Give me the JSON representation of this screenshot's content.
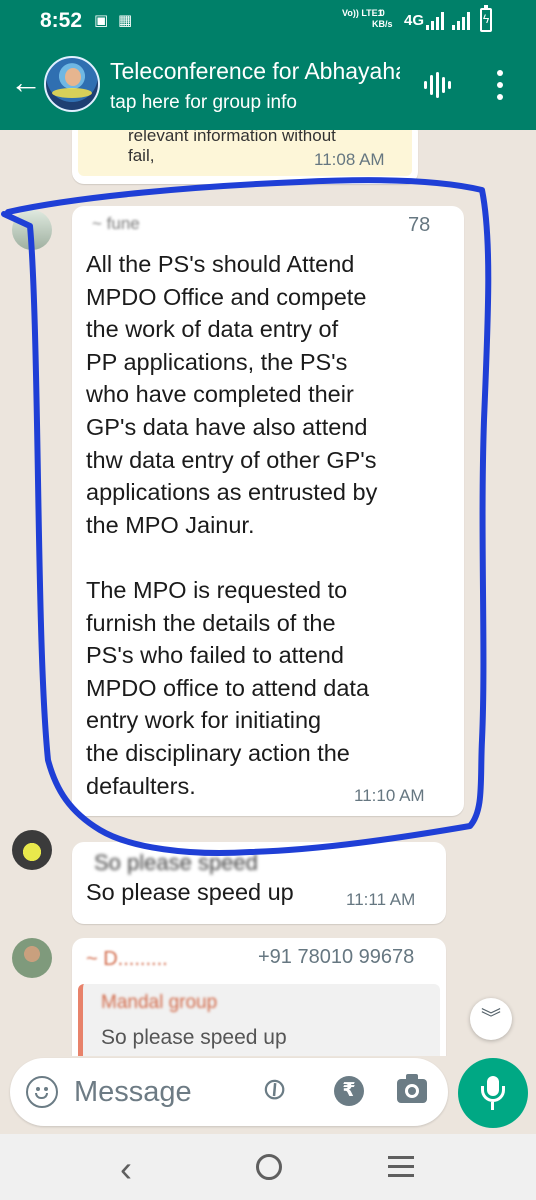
{
  "status_bar": {
    "time": "8:52",
    "indicators": [
      "gallery-icon",
      "calendar-icon"
    ],
    "volte": "Vo)) LTE1",
    "speed_value": "0",
    "speed_unit": "KB/s",
    "network": "4G"
  },
  "header": {
    "title": "Teleconference for Abhayahasth...",
    "subtitle": "tap here for group info"
  },
  "messages": {
    "top": {
      "text_line1": "relevant information without",
      "text_line2": "fail,",
      "time": "11:08 AM"
    },
    "main": {
      "sender": "~ fune",
      "number": "78",
      "text_line1": "All the PS's should Attend",
      "text_line2": "MPDO Office and compete",
      "text_line3": "the work of data entry of",
      "text_line4": "PP applications, the PS's",
      "text_line5": "who have completed  their",
      "text_line6": "GP's data have also attend",
      "text_line7": "thw data entry of other GP's",
      "text_line8": "applications as entrusted by",
      "text_line9": "the MPO Jainur.",
      "text_line10": "The MPO is requested to",
      "text_line11": "furnish the details of the",
      "text_line12": "PS's who failed to attend",
      "text_line13": "MPDO  office to attend data",
      "text_line14": "entry work for initiating",
      "text_line15": "the disciplinary action the",
      "text_line16": "defaulters.",
      "time": "11:10 AM"
    },
    "speed1": {
      "sender_blurred": "So please speed",
      "text": "So please speed up",
      "time": "11:11 AM"
    },
    "quoted": {
      "sender": "~ D.........",
      "phone": "+91 78010 99678",
      "quote_sender": "Mandal group",
      "quote_text": "So please speed up"
    }
  },
  "input": {
    "placeholder": "Message",
    "rupee_symbol": "₹"
  },
  "colors": {
    "header": "#008069",
    "accent": "#00a884",
    "chat_bg": "#ece5dd",
    "annotation": "#1f3fd6"
  }
}
